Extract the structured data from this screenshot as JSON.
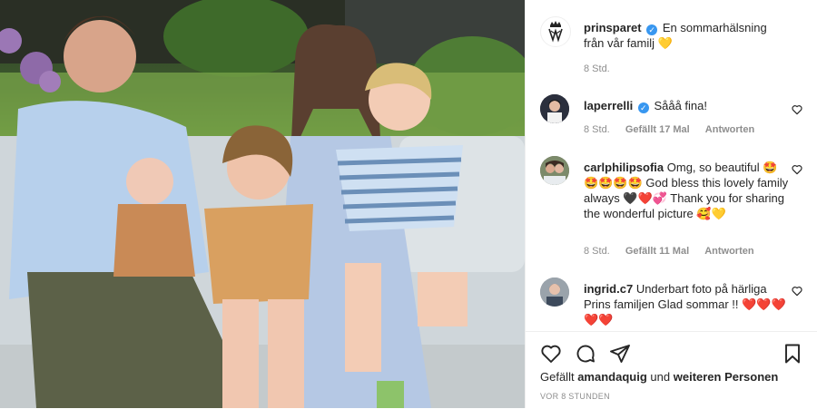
{
  "post": {
    "account": "prinsparet",
    "caption": "En sommarhälsning från vår familj",
    "caption_emoji": "💛",
    "caption_time": "8 Std."
  },
  "comments": [
    {
      "user": "laperrelli",
      "verified": true,
      "text": "Sååå fina!",
      "time": "8 Std.",
      "likes": "Gefällt 17 Mal",
      "reply": "Antworten"
    },
    {
      "user": "carlphilipsofia",
      "verified": false,
      "text": "Omg, so beautiful 🤩🤩🤩🤩🤩 God bless this lovely family always 🖤❤️💞 Thank you for sharing the wonderful picture 🥰💛",
      "time": "8 Std.",
      "likes": "Gefällt 11 Mal",
      "reply": "Antworten"
    },
    {
      "user": "ingrid.c7",
      "verified": false,
      "text": "Underbart foto på härliga Prins familjen Glad sommar !! ❤️❤️❤️❤️❤️"
    }
  ],
  "footer": {
    "likes_prefix": "Gefällt",
    "likes_user": "amandaquig",
    "likes_mid": "und",
    "likes_rest": "weiteren Personen",
    "timestamp": "VOR 8 STUNDEN"
  },
  "icons": {
    "like": "heart-outline-icon",
    "comment": "comment-bubble-icon",
    "share": "paper-plane-icon",
    "save": "bookmark-icon",
    "comment_like": "heart-small-icon",
    "verified": "verified-badge-icon"
  },
  "colors": {
    "verified_blue": "#3897f0",
    "muted_text": "#8e8e8e",
    "text": "#262626",
    "border": "#efefef"
  }
}
